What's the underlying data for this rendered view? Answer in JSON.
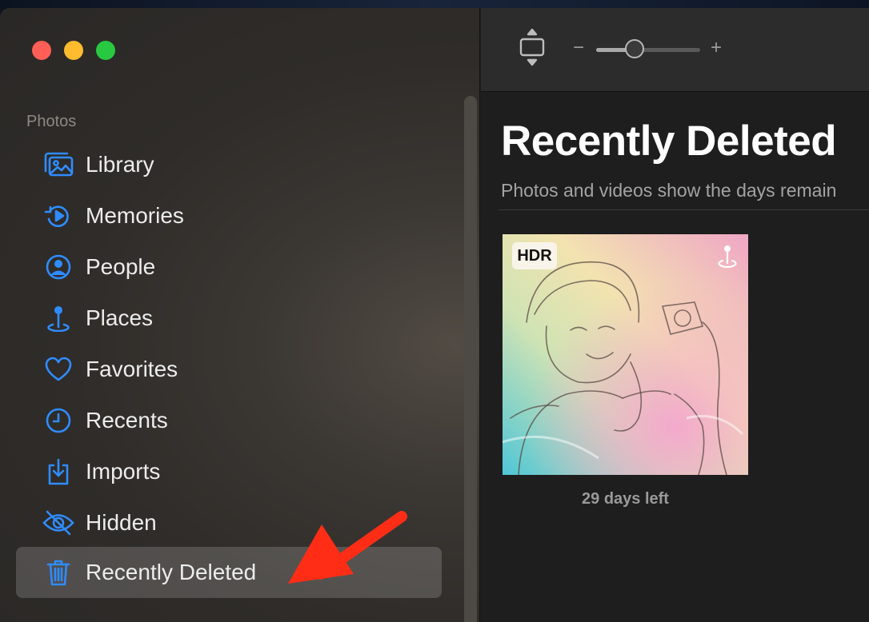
{
  "window": {
    "traffic_lights": {
      "close_color": "#ff5f57",
      "minimize_color": "#febc2e",
      "maximize_color": "#28c840"
    }
  },
  "sidebar": {
    "section_label": "Photos",
    "accent_color": "#2f8cff",
    "items": [
      {
        "label": "Library",
        "icon": "photo-library-icon",
        "selected": false
      },
      {
        "label": "Memories",
        "icon": "memories-icon",
        "selected": false
      },
      {
        "label": "People",
        "icon": "person-circle-icon",
        "selected": false
      },
      {
        "label": "Places",
        "icon": "map-pin-icon",
        "selected": false
      },
      {
        "label": "Favorites",
        "icon": "heart-icon",
        "selected": false
      },
      {
        "label": "Recents",
        "icon": "clock-icon",
        "selected": false
      },
      {
        "label": "Imports",
        "icon": "import-tray-icon",
        "selected": false
      },
      {
        "label": "Hidden",
        "icon": "eye-slash-icon",
        "selected": false
      },
      {
        "label": "Recently Deleted",
        "icon": "trash-icon",
        "selected": true
      }
    ]
  },
  "toolbar": {
    "aspect_icon": "aspect-ratio-icon",
    "zoom_minus_label": "−",
    "zoom_plus_label": "+",
    "zoom_level": 0.37
  },
  "main": {
    "title": "Recently Deleted",
    "subtitle": "Photos and videos show the days remain",
    "photos": [
      {
        "badge": "HDR",
        "corner_icon": "location-icon",
        "caption": "29 days left"
      }
    ]
  },
  "annotation": {
    "arrow_color": "#ff2d16",
    "points_to": "Recently Deleted"
  }
}
